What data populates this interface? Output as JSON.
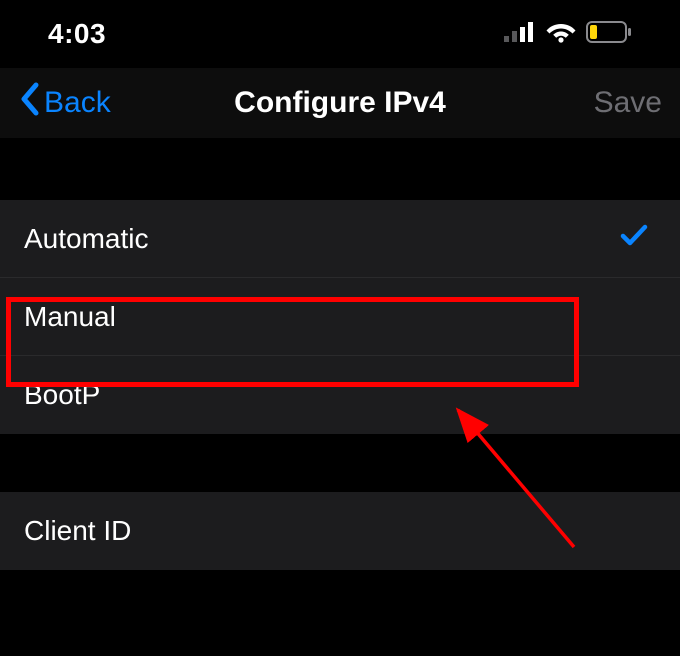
{
  "status": {
    "time": "4:03"
  },
  "nav": {
    "back_label": "Back",
    "title": "Configure IPv4",
    "save_label": "Save"
  },
  "options": {
    "automatic": "Automatic",
    "manual": "Manual",
    "bootp": "BootP",
    "selected": "automatic"
  },
  "section2": {
    "client_id": "Client ID"
  }
}
